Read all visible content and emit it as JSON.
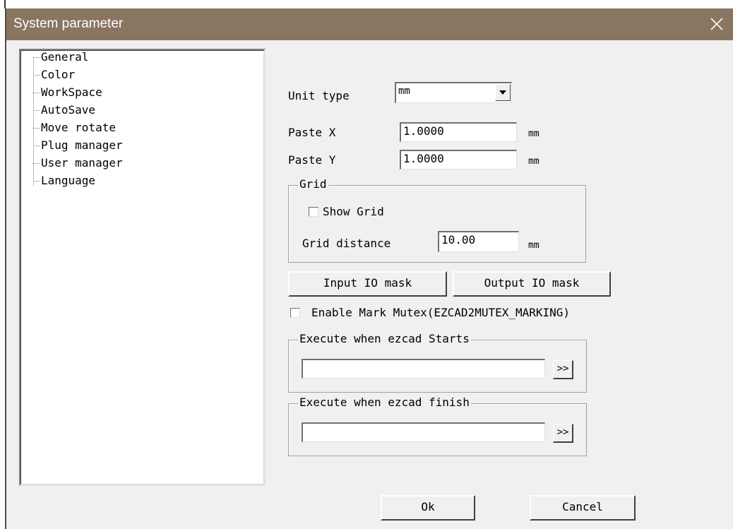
{
  "window": {
    "title": "System parameter"
  },
  "tree": {
    "items": [
      {
        "label": "General"
      },
      {
        "label": "Color"
      },
      {
        "label": "WorkSpace"
      },
      {
        "label": "AutoSave"
      },
      {
        "label": "Move rotate"
      },
      {
        "label": "Plug manager"
      },
      {
        "label": "User manager"
      },
      {
        "label": "Language"
      }
    ]
  },
  "general": {
    "unit_type_label": "Unit type",
    "unit_type_value": "mm",
    "paste_x_label": "Paste X",
    "paste_x_value": "1.0000",
    "paste_x_unit": "mm",
    "paste_y_label": "Paste Y",
    "paste_y_value": "1.0000",
    "paste_y_unit": "mm",
    "grid": {
      "title": "Grid",
      "show_grid_label": "Show Grid",
      "show_grid_checked": false,
      "distance_label": "Grid distance",
      "distance_value": "10.00",
      "distance_unit": "mm"
    },
    "input_io_mask_label": "Input IO mask",
    "output_io_mask_label": "Output IO mask",
    "mark_mutex_label": "Enable Mark Mutex(EZCAD2MUTEX_MARKING)",
    "mark_mutex_checked": false,
    "exec_start": {
      "title": "Execute when ezcad Starts",
      "value": "",
      "browse_label": ">>"
    },
    "exec_finish": {
      "title": "Execute when ezcad finish",
      "value": "",
      "browse_label": ">>"
    }
  },
  "footer": {
    "ok_label": "Ok",
    "cancel_label": "Cancel"
  }
}
